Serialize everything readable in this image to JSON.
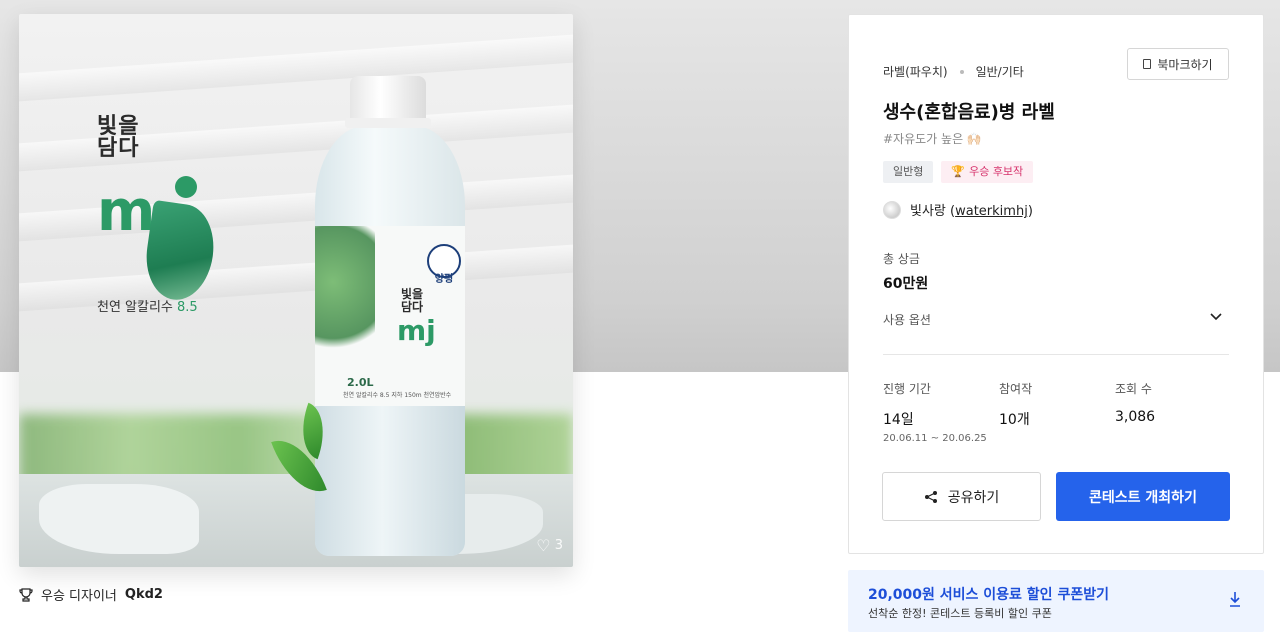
{
  "hero": {
    "brand_ko": "빛을\n담다",
    "brand_mj": "m",
    "brand_sub_prefix": "천연 알칼리수 ",
    "brand_sub_ph": "8.5",
    "label_badge": "양평",
    "label_ko": "빛을\n담다",
    "label_mj": "mj",
    "label_volume": "2.0L",
    "label_desc": "천연 알칼리수 8.5  지하 150m 천연암반수",
    "like_count": "3"
  },
  "designer": {
    "prefix": "우승 디자이너",
    "name": "Qkd2"
  },
  "card": {
    "category_main": "라벨(파우치)",
    "category_sub": "일반/기타",
    "bookmark_label": "북마크하기",
    "title": "생수(혼합음료)병 라벨",
    "tagline": "#자유도가 높은 🙌🏻",
    "chip_type": "일반형",
    "chip_winner": "우승 후보작",
    "author_name": "빛사랑",
    "author_handle": "waterkimhj",
    "prize_label": "총 상금",
    "prize_value": "60만원",
    "usage_label": "사용 옵션",
    "stats": [
      {
        "label": "진행 기간",
        "value": "14일",
        "sub": "20.06.11 ~ 20.06.25"
      },
      {
        "label": "참여작",
        "value": "10개",
        "sub": ""
      },
      {
        "label": "조회 수",
        "value": "3,086",
        "sub": ""
      }
    ],
    "share_label": "공유하기",
    "host_label": "콘테스트 개최하기"
  },
  "coupon": {
    "title": "20,000원 서비스 이용료 할인 쿠폰받기",
    "subtitle": "선착순 한정! 콘테스트 등록비 할인 쿠폰"
  },
  "colors": {
    "accent": "#2563eb",
    "brand_green": "#2c9a66",
    "winner_pink": "#d6336c"
  }
}
